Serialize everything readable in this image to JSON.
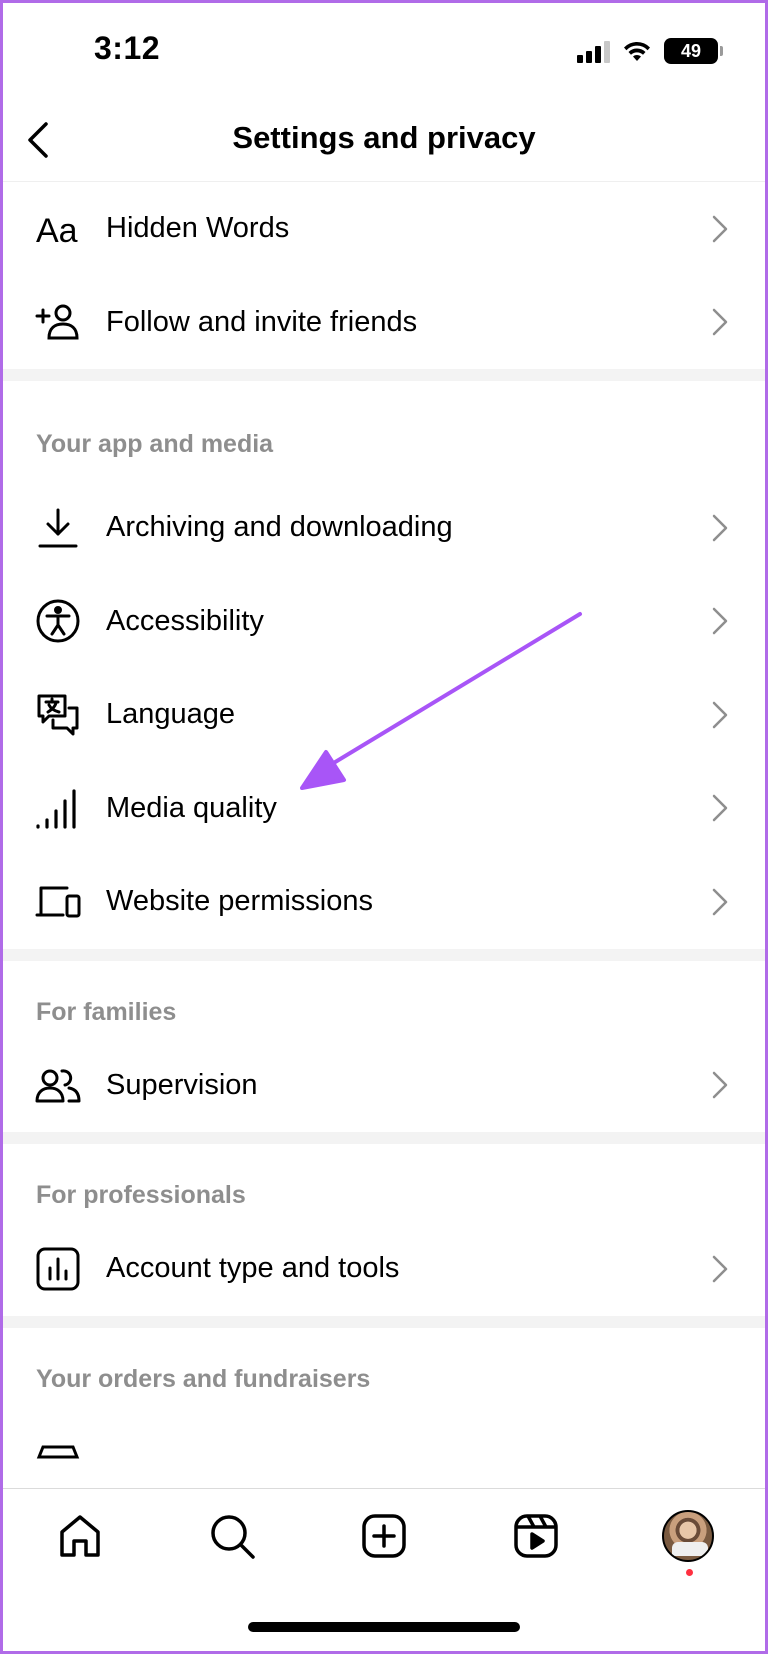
{
  "status_bar": {
    "time": "3:12",
    "battery": "49",
    "battery_icon": "battery-icon",
    "signal_icon": "cellular-signal-icon",
    "wifi_icon": "wifi-icon"
  },
  "header": {
    "title": "Settings and privacy",
    "back_icon": "chevron-left-icon"
  },
  "sections": [
    {
      "header": "",
      "items": [
        {
          "label": "Hidden Words",
          "icon": "text-aa-icon"
        },
        {
          "label": "Follow and invite friends",
          "icon": "add-person-icon"
        }
      ]
    },
    {
      "header": "Your app and media",
      "items": [
        {
          "label": "Archiving and downloading",
          "icon": "download-icon"
        },
        {
          "label": "Accessibility",
          "icon": "accessibility-icon"
        },
        {
          "label": "Language",
          "icon": "translate-icon"
        },
        {
          "label": "Media quality",
          "icon": "signal-bars-icon"
        },
        {
          "label": "Website permissions",
          "icon": "devices-icon"
        }
      ]
    },
    {
      "header": "For families",
      "items": [
        {
          "label": "Supervision",
          "icon": "people-icon"
        }
      ]
    },
    {
      "header": "For professionals",
      "items": [
        {
          "label": "Account type and tools",
          "icon": "bar-chart-icon"
        }
      ]
    },
    {
      "header": "Your orders and fundraisers",
      "items": []
    }
  ],
  "annotation": {
    "type": "arrow",
    "color": "#a855f7",
    "points_to": "Media quality"
  },
  "tab_bar": {
    "items": [
      "home-icon",
      "search-icon",
      "create-icon",
      "reels-icon",
      "profile-avatar"
    ],
    "notification_dot_color": "#ff3040"
  },
  "colors": {
    "accent_frame": "#b06be8",
    "section_header": "#8e8e8e",
    "divider": "#f3f3f3"
  }
}
